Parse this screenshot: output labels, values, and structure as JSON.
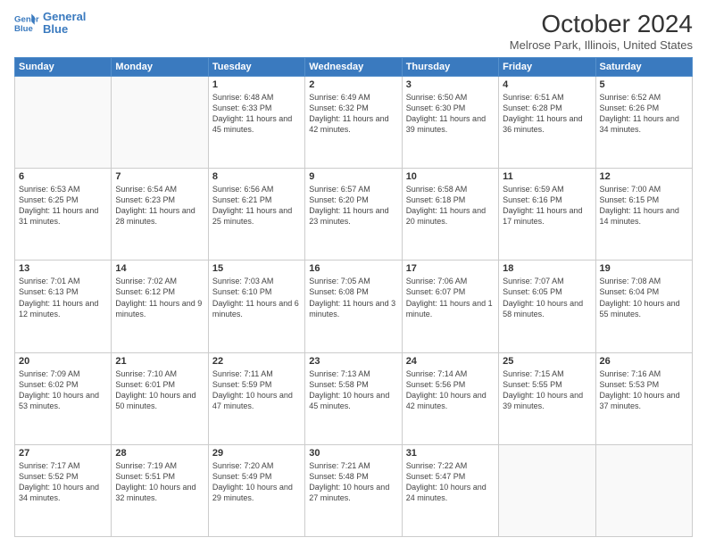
{
  "header": {
    "logo_line1": "General",
    "logo_line2": "Blue",
    "month": "October 2024",
    "location": "Melrose Park, Illinois, United States"
  },
  "weekdays": [
    "Sunday",
    "Monday",
    "Tuesday",
    "Wednesday",
    "Thursday",
    "Friday",
    "Saturday"
  ],
  "weeks": [
    [
      {
        "day": "",
        "info": ""
      },
      {
        "day": "",
        "info": ""
      },
      {
        "day": "1",
        "info": "Sunrise: 6:48 AM\nSunset: 6:33 PM\nDaylight: 11 hours and 45 minutes."
      },
      {
        "day": "2",
        "info": "Sunrise: 6:49 AM\nSunset: 6:32 PM\nDaylight: 11 hours and 42 minutes."
      },
      {
        "day": "3",
        "info": "Sunrise: 6:50 AM\nSunset: 6:30 PM\nDaylight: 11 hours and 39 minutes."
      },
      {
        "day": "4",
        "info": "Sunrise: 6:51 AM\nSunset: 6:28 PM\nDaylight: 11 hours and 36 minutes."
      },
      {
        "day": "5",
        "info": "Sunrise: 6:52 AM\nSunset: 6:26 PM\nDaylight: 11 hours and 34 minutes."
      }
    ],
    [
      {
        "day": "6",
        "info": "Sunrise: 6:53 AM\nSunset: 6:25 PM\nDaylight: 11 hours and 31 minutes."
      },
      {
        "day": "7",
        "info": "Sunrise: 6:54 AM\nSunset: 6:23 PM\nDaylight: 11 hours and 28 minutes."
      },
      {
        "day": "8",
        "info": "Sunrise: 6:56 AM\nSunset: 6:21 PM\nDaylight: 11 hours and 25 minutes."
      },
      {
        "day": "9",
        "info": "Sunrise: 6:57 AM\nSunset: 6:20 PM\nDaylight: 11 hours and 23 minutes."
      },
      {
        "day": "10",
        "info": "Sunrise: 6:58 AM\nSunset: 6:18 PM\nDaylight: 11 hours and 20 minutes."
      },
      {
        "day": "11",
        "info": "Sunrise: 6:59 AM\nSunset: 6:16 PM\nDaylight: 11 hours and 17 minutes."
      },
      {
        "day": "12",
        "info": "Sunrise: 7:00 AM\nSunset: 6:15 PM\nDaylight: 11 hours and 14 minutes."
      }
    ],
    [
      {
        "day": "13",
        "info": "Sunrise: 7:01 AM\nSunset: 6:13 PM\nDaylight: 11 hours and 12 minutes."
      },
      {
        "day": "14",
        "info": "Sunrise: 7:02 AM\nSunset: 6:12 PM\nDaylight: 11 hours and 9 minutes."
      },
      {
        "day": "15",
        "info": "Sunrise: 7:03 AM\nSunset: 6:10 PM\nDaylight: 11 hours and 6 minutes."
      },
      {
        "day": "16",
        "info": "Sunrise: 7:05 AM\nSunset: 6:08 PM\nDaylight: 11 hours and 3 minutes."
      },
      {
        "day": "17",
        "info": "Sunrise: 7:06 AM\nSunset: 6:07 PM\nDaylight: 11 hours and 1 minute."
      },
      {
        "day": "18",
        "info": "Sunrise: 7:07 AM\nSunset: 6:05 PM\nDaylight: 10 hours and 58 minutes."
      },
      {
        "day": "19",
        "info": "Sunrise: 7:08 AM\nSunset: 6:04 PM\nDaylight: 10 hours and 55 minutes."
      }
    ],
    [
      {
        "day": "20",
        "info": "Sunrise: 7:09 AM\nSunset: 6:02 PM\nDaylight: 10 hours and 53 minutes."
      },
      {
        "day": "21",
        "info": "Sunrise: 7:10 AM\nSunset: 6:01 PM\nDaylight: 10 hours and 50 minutes."
      },
      {
        "day": "22",
        "info": "Sunrise: 7:11 AM\nSunset: 5:59 PM\nDaylight: 10 hours and 47 minutes."
      },
      {
        "day": "23",
        "info": "Sunrise: 7:13 AM\nSunset: 5:58 PM\nDaylight: 10 hours and 45 minutes."
      },
      {
        "day": "24",
        "info": "Sunrise: 7:14 AM\nSunset: 5:56 PM\nDaylight: 10 hours and 42 minutes."
      },
      {
        "day": "25",
        "info": "Sunrise: 7:15 AM\nSunset: 5:55 PM\nDaylight: 10 hours and 39 minutes."
      },
      {
        "day": "26",
        "info": "Sunrise: 7:16 AM\nSunset: 5:53 PM\nDaylight: 10 hours and 37 minutes."
      }
    ],
    [
      {
        "day": "27",
        "info": "Sunrise: 7:17 AM\nSunset: 5:52 PM\nDaylight: 10 hours and 34 minutes."
      },
      {
        "day": "28",
        "info": "Sunrise: 7:19 AM\nSunset: 5:51 PM\nDaylight: 10 hours and 32 minutes."
      },
      {
        "day": "29",
        "info": "Sunrise: 7:20 AM\nSunset: 5:49 PM\nDaylight: 10 hours and 29 minutes."
      },
      {
        "day": "30",
        "info": "Sunrise: 7:21 AM\nSunset: 5:48 PM\nDaylight: 10 hours and 27 minutes."
      },
      {
        "day": "31",
        "info": "Sunrise: 7:22 AM\nSunset: 5:47 PM\nDaylight: 10 hours and 24 minutes."
      },
      {
        "day": "",
        "info": ""
      },
      {
        "day": "",
        "info": ""
      }
    ]
  ]
}
